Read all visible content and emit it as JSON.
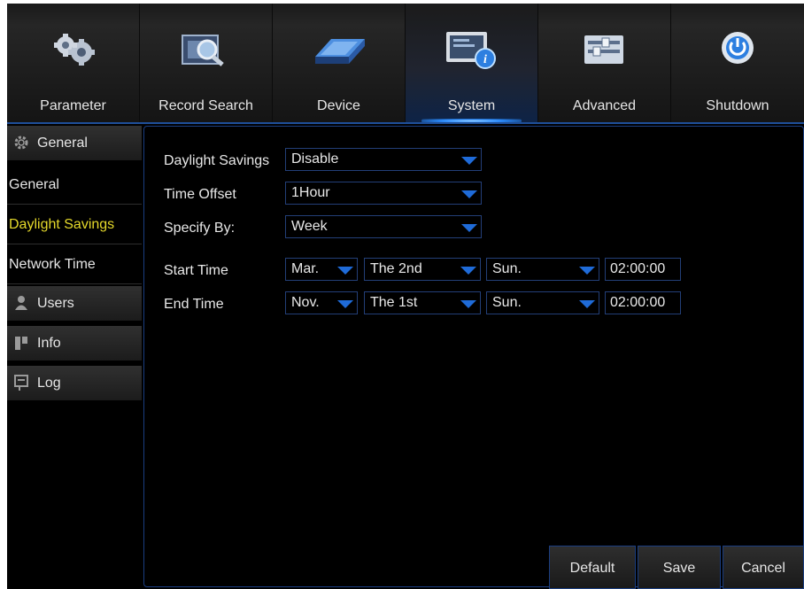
{
  "top_tabs": [
    {
      "label": "Parameter",
      "icon": "gears-icon"
    },
    {
      "label": "Record Search",
      "icon": "film-search-icon"
    },
    {
      "label": "Device",
      "icon": "hard-drive-icon"
    },
    {
      "label": "System",
      "icon": "monitor-info-icon"
    },
    {
      "label": "Advanced",
      "icon": "sliders-icon"
    },
    {
      "label": "Shutdown",
      "icon": "power-icon"
    }
  ],
  "active_tab": "System",
  "sidebar": {
    "sections": [
      {
        "label": "General",
        "icon": "gear-icon"
      },
      {
        "label": "Users",
        "icon": "user-icon"
      },
      {
        "label": "Info",
        "icon": "info-icon"
      },
      {
        "label": "Log",
        "icon": "log-icon"
      }
    ],
    "sub_items": [
      {
        "label": "General"
      },
      {
        "label": "Daylight Savings"
      },
      {
        "label": "Network Time"
      }
    ],
    "active_sub": "Daylight Savings"
  },
  "form": {
    "daylight_savings": {
      "label": "Daylight Savings",
      "value": "Disable"
    },
    "time_offset": {
      "label": "Time Offset",
      "value": "1Hour"
    },
    "specify_by": {
      "label": "Specify By:",
      "value": "Week"
    },
    "start_time": {
      "label": "Start Time",
      "month": "Mar.",
      "week": "The 2nd",
      "day": "Sun.",
      "time": "02:00:00"
    },
    "end_time": {
      "label": "End Time",
      "month": "Nov.",
      "week": "The 1st",
      "day": "Sun.",
      "time": "02:00:00"
    }
  },
  "buttons": {
    "default": "Default",
    "save": "Save",
    "cancel": "Cancel"
  },
  "colors": {
    "accent": "#1f6bd8",
    "active_sidebar": "#e5d92b",
    "border": "#1a3d80"
  }
}
